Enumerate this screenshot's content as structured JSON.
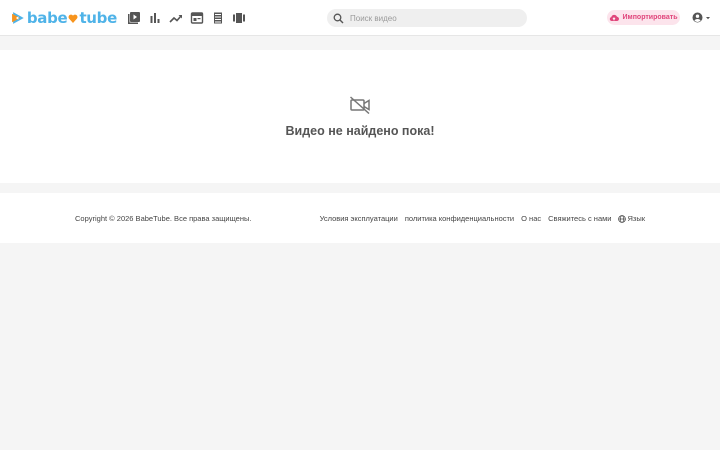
{
  "brand": {
    "name_part1": "babe",
    "name_part2": "tube",
    "logo_icon": "play-logo-icon",
    "colors": {
      "blue": "#4fb3e8",
      "orange": "#f7941d",
      "pink": "#e0457b"
    }
  },
  "nav": {
    "items": [
      {
        "icon": "video-library-icon"
      },
      {
        "icon": "bar-chart-icon"
      },
      {
        "icon": "trending-icon"
      },
      {
        "icon": "web-layout-icon"
      },
      {
        "icon": "list-icon"
      },
      {
        "icon": "carousel-icon"
      }
    ]
  },
  "search": {
    "placeholder": "Поиск видео",
    "value": "",
    "icon": "search-icon"
  },
  "import_button": {
    "label": "Импортировать",
    "icon": "cloud-upload-icon"
  },
  "account": {
    "icon": "account-circle-icon",
    "chevron": "chevron-down-icon"
  },
  "content": {
    "empty_icon": "videocam-off-icon",
    "empty_message": "Видео не найдено пока!"
  },
  "footer": {
    "copyright": "Copyright © 2026 BabeTube. Все права защищены.",
    "links": [
      {
        "label": "Условия эксплуатации"
      },
      {
        "label": "политика конфиденциальности"
      },
      {
        "label": "О нас"
      },
      {
        "label": "Свяжитесь с нами"
      }
    ],
    "language": {
      "label": "Язык",
      "icon": "globe-icon"
    }
  }
}
